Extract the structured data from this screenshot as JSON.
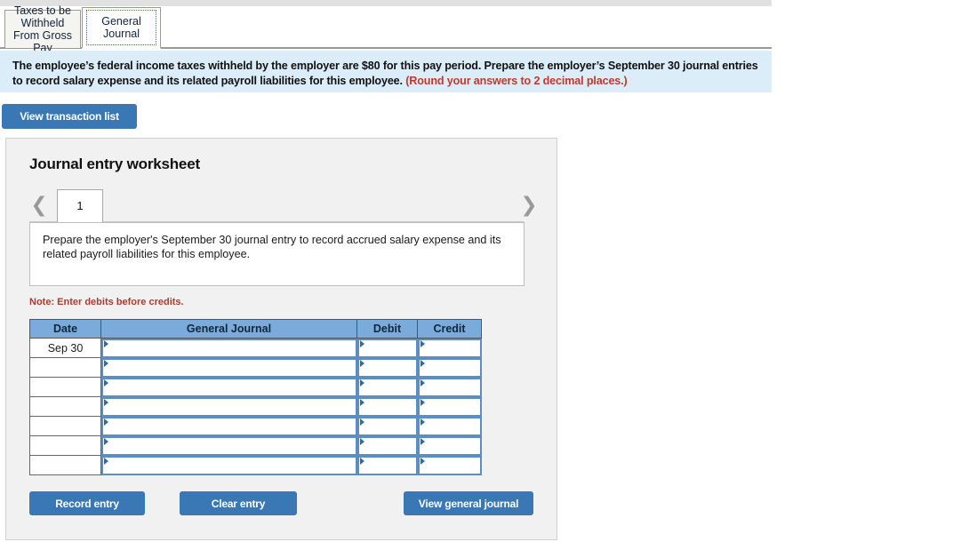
{
  "tabs": [
    {
      "label": "Taxes to be Withheld From Gross Pay",
      "active": false
    },
    {
      "label": "General Journal",
      "active": true
    }
  ],
  "banner": {
    "text": "The employee’s federal income taxes withheld by the employer are $80 for this pay period. Prepare the employer’s September 30 journal entries to record salary expense and its related payroll liabilities for this employee.",
    "rounding_note": "(Round your answers to 2 decimal places.)",
    "background_color": "#dcedfa",
    "note_color": "#c0392b"
  },
  "toolbar": {
    "view_transaction_list_label": "View transaction list"
  },
  "worksheet": {
    "title": "Journal entry worksheet",
    "pager": {
      "prev_icon": "chevron-left-icon",
      "next_icon": "chevron-right-icon",
      "current_page": "1"
    },
    "prompt": "Prepare the employer's September 30 journal entry to record accrued salary expense and its related payroll liabilities for this employee.",
    "note": "Note: Enter debits before credits.",
    "table": {
      "headers": [
        "Date",
        "General Journal",
        "Debit",
        "Credit"
      ],
      "header_color": "#7aabda",
      "rows": [
        {
          "date": "Sep 30",
          "general_journal": "",
          "debit": "",
          "credit": ""
        },
        {
          "date": "",
          "general_journal": "",
          "debit": "",
          "credit": ""
        },
        {
          "date": "",
          "general_journal": "",
          "debit": "",
          "credit": ""
        },
        {
          "date": "",
          "general_journal": "",
          "debit": "",
          "credit": ""
        },
        {
          "date": "",
          "general_journal": "",
          "debit": "",
          "credit": ""
        },
        {
          "date": "",
          "general_journal": "",
          "debit": "",
          "credit": ""
        },
        {
          "date": "",
          "general_journal": "",
          "debit": "",
          "credit": ""
        }
      ]
    },
    "buttons": {
      "record_entry": "Record entry",
      "clear_entry": "Clear entry",
      "view_general_journal": "View general journal",
      "color": "#3a77b5"
    }
  }
}
